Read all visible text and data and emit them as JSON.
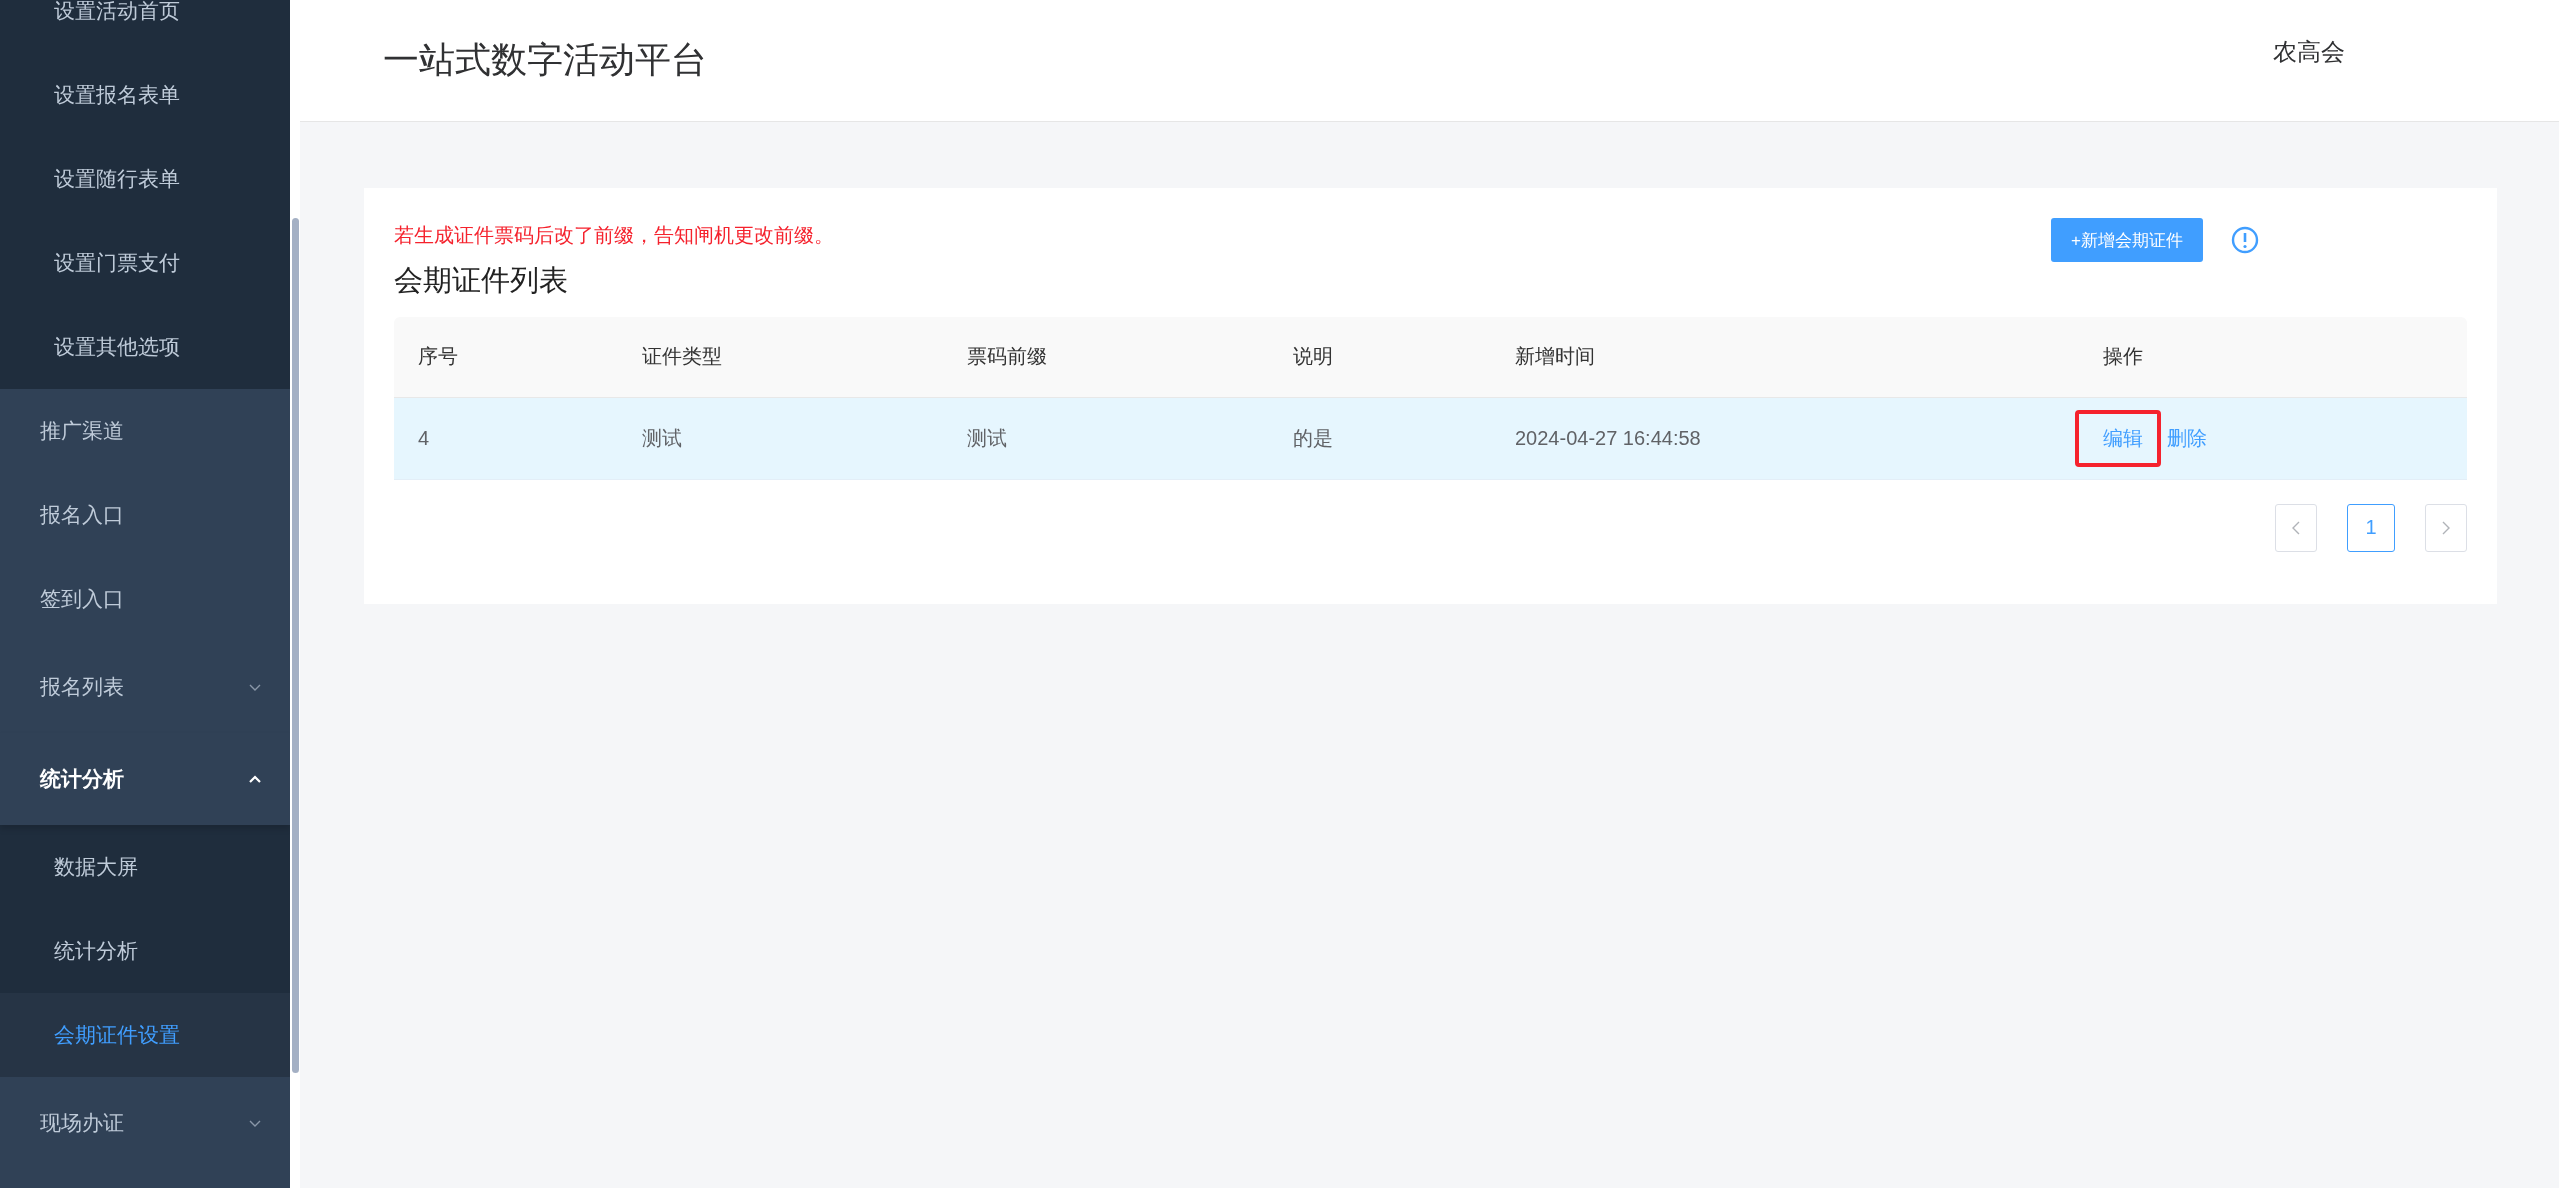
{
  "sidebar": {
    "items": [
      {
        "label": "设置活动首页",
        "kind": "sub",
        "selected": false
      },
      {
        "label": "设置报名表单",
        "kind": "sub",
        "selected": false
      },
      {
        "label": "设置随行表单",
        "kind": "sub",
        "selected": false
      },
      {
        "label": "设置门票支付",
        "kind": "sub",
        "selected": false
      },
      {
        "label": "设置其他选项",
        "kind": "sub",
        "selected": false
      },
      {
        "label": "推广渠道",
        "kind": "item",
        "selected": false
      },
      {
        "label": "报名入口",
        "kind": "item",
        "selected": false
      },
      {
        "label": "签到入口",
        "kind": "item",
        "selected": false
      },
      {
        "label": "报名列表",
        "kind": "group",
        "expanded": false,
        "selected": false
      },
      {
        "label": "统计分析",
        "kind": "group",
        "expanded": true,
        "selected": false,
        "children": [
          {
            "label": "数据大屏",
            "selected": false
          },
          {
            "label": "统计分析",
            "selected": false
          },
          {
            "label": "会期证件设置",
            "selected": true
          }
        ]
      },
      {
        "label": "现场办证",
        "kind": "group",
        "expanded": false,
        "selected": false
      }
    ]
  },
  "header": {
    "title": "一站式数字活动平台",
    "user": "农高会"
  },
  "card": {
    "notice": "若生成证件票码后改了前缀，告知闸机更改前缀。",
    "title": "会期证件列表",
    "add_button": "+新增会期证件",
    "table": {
      "columns": [
        "序号",
        "证件类型",
        "票码前缀",
        "说明",
        "新增时间",
        "操作"
      ],
      "rows": [
        {
          "cells": [
            "4",
            "测试",
            "测试",
            "的是",
            "2024-04-27 16:44:58"
          ],
          "selected": true,
          "actions": [
            {
              "label": "编辑",
              "highlighted": true
            },
            {
              "label": "删除",
              "highlighted": false
            }
          ]
        }
      ]
    },
    "pagination": {
      "pages": [
        {
          "label": "1",
          "selected": true
        }
      ]
    }
  }
}
